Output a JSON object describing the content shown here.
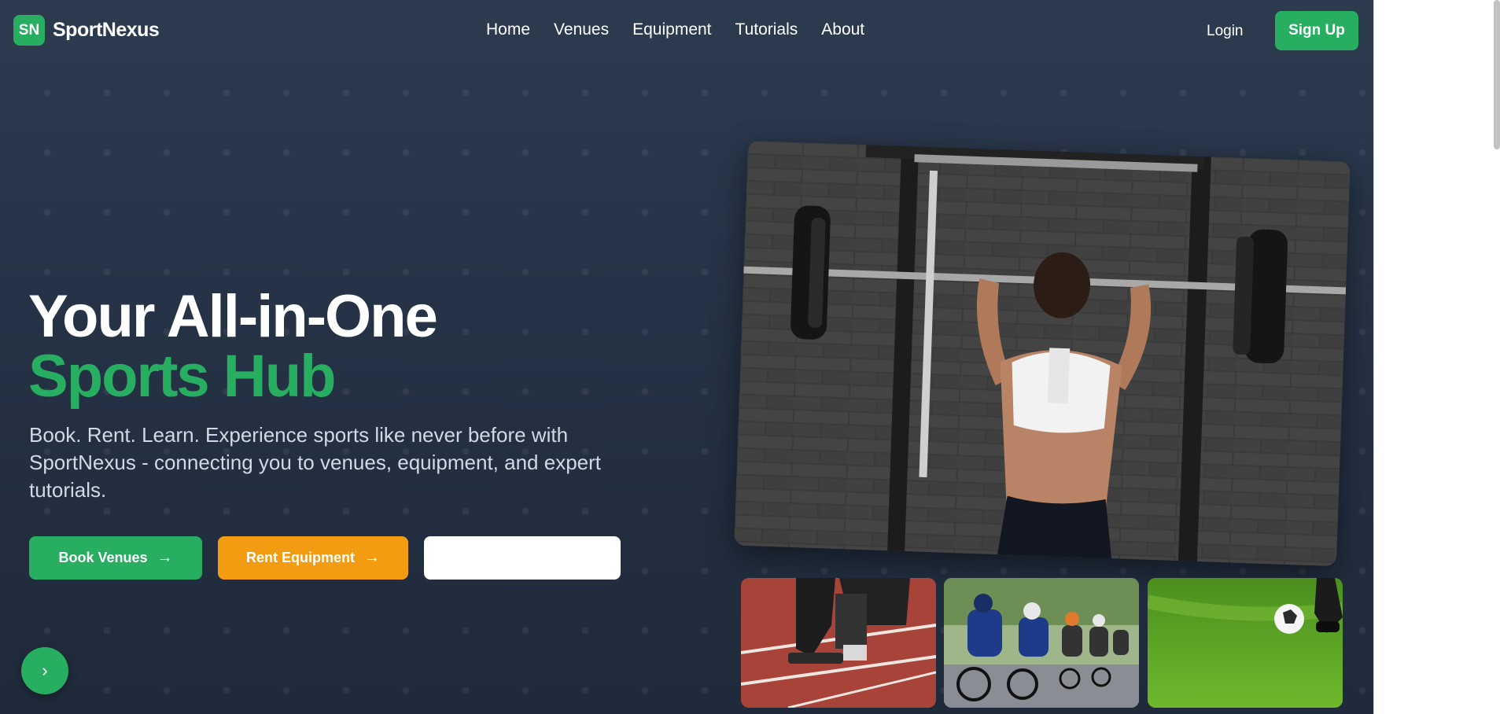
{
  "brand": {
    "badge": "SN",
    "name": "SportNexus"
  },
  "nav": {
    "links": [
      {
        "label": "Home"
      },
      {
        "label": "Venues"
      },
      {
        "label": "Equipment"
      },
      {
        "label": "Tutorials"
      },
      {
        "label": "About"
      }
    ],
    "login_label": "Login",
    "signup_label": "Sign Up"
  },
  "hero": {
    "title_line1": "Your All-in-One",
    "title_line2": "Sports Hub",
    "subtitle": "Book. Rent. Learn. Experience sports like never before with SportNexus - connecting you to venues, equipment, and expert tutorials.",
    "buttons": {
      "book": "Book Venues",
      "rent": "Rent Equipment",
      "third": ""
    }
  },
  "images": {
    "main": "weightlifting-photo",
    "thumbs": [
      "sprint-start-photo",
      "cycling-peloton-photo",
      "soccer-ball-photo"
    ]
  },
  "colors": {
    "accent_green": "#27ae60",
    "accent_orange": "#f39c12",
    "background": "#263346"
  },
  "icons": {
    "arrow": "arrow-right-icon",
    "fab": "chevron-right-icon"
  }
}
